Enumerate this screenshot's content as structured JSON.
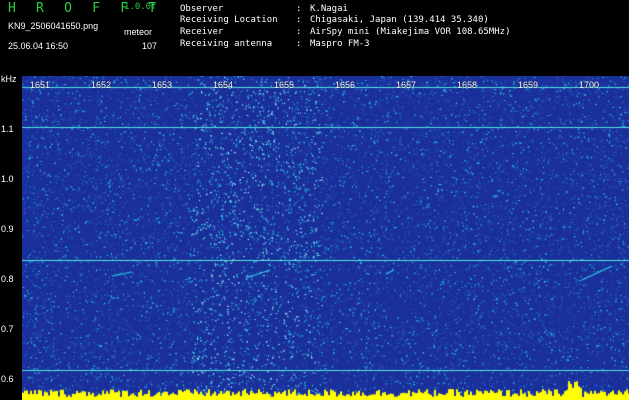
{
  "header": {
    "app_title": "H R O F F T",
    "version": "1.0.0f",
    "file_name": "KN9_2506041650.png",
    "mode": "meteor",
    "timestamp": "25.06.04 16:50",
    "count": "107",
    "metadata": [
      {
        "label": "Observer",
        "value": "K.Nagai"
      },
      {
        "label": "Receiving Location",
        "value": "Chigasaki, Japan (139.414 35.340)"
      },
      {
        "label": "Receiver",
        "value": "AirSpy mini (Miakejima VOR 108.65MHz)"
      },
      {
        "label": "Receiving antenna",
        "value": "Maspro FM-3"
      }
    ],
    "separator": ":"
  },
  "axes": {
    "y_unit": "kHz",
    "y_ticks": [
      "1.1",
      "1.0",
      "0.9",
      "0.8",
      "0.7",
      "0.6"
    ],
    "x_ticks": [
      "1651",
      "1652",
      "1653",
      "1654",
      "1655",
      "1656",
      "1657",
      "1658",
      "1659",
      "1700"
    ]
  },
  "colors": {
    "background": "#1a2f9a",
    "noise": "#2ad2e8",
    "line": "#4fe8e0",
    "amplitude": "#ffff00",
    "title": "#2ecc40"
  }
}
